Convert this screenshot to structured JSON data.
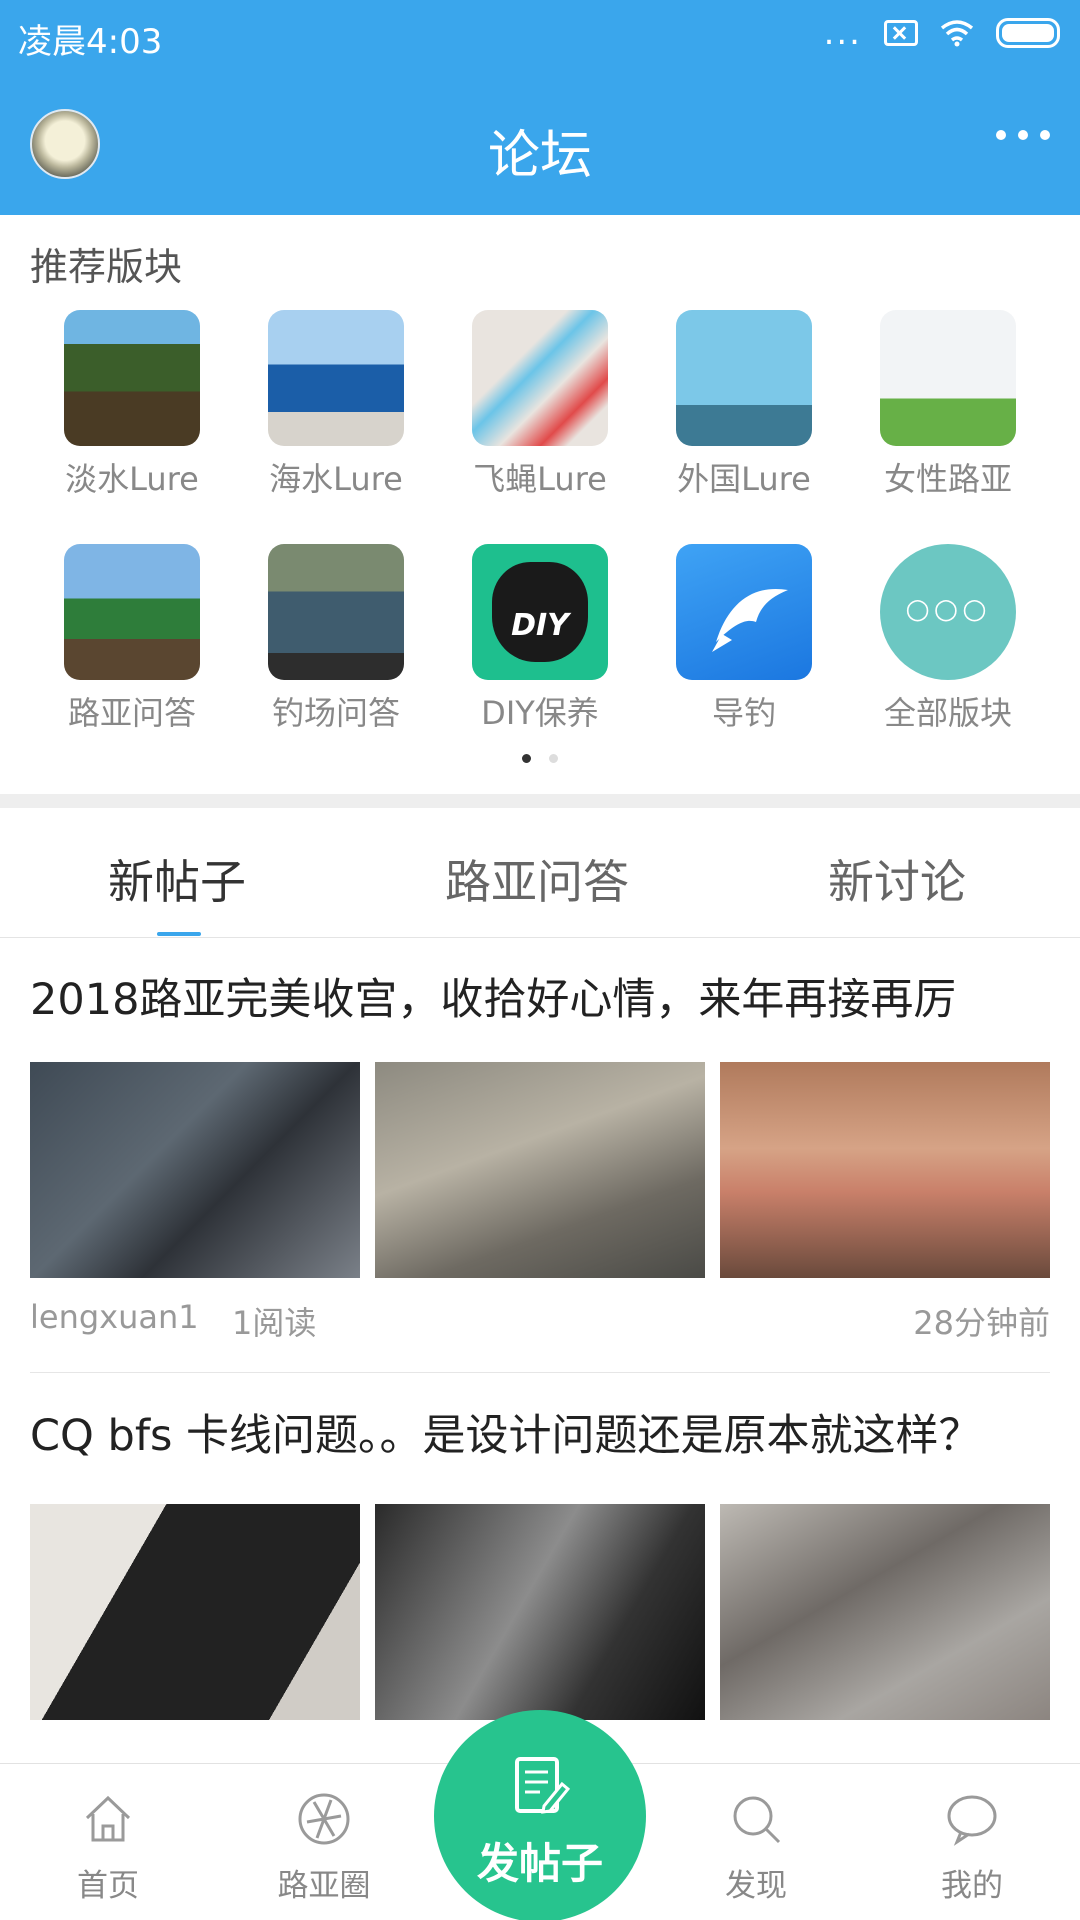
{
  "status_bar": {
    "time": "凌晨4:03",
    "dots": "...",
    "icons": [
      "dots-icon",
      "no-sim-icon",
      "wifi-icon",
      "battery-icon"
    ]
  },
  "appbar": {
    "title": "论坛"
  },
  "recommended": {
    "title": "推荐版块",
    "items": [
      {
        "label": "淡水Lure"
      },
      {
        "label": "海水Lure"
      },
      {
        "label": "飞蝇Lure"
      },
      {
        "label": "外国Lure"
      },
      {
        "label": "女性路亚"
      },
      {
        "label": "路亚问答"
      },
      {
        "label": "钓场问答"
      },
      {
        "label": "DIY保养",
        "badge": "DIY"
      },
      {
        "label": "导钓"
      },
      {
        "label": "全部版块"
      }
    ],
    "page": 1,
    "page_count": 2
  },
  "tabs": [
    {
      "label": "新帖子",
      "active": true
    },
    {
      "label": "路亚问答",
      "active": false
    },
    {
      "label": "新讨论",
      "active": false
    }
  ],
  "posts": [
    {
      "title": "2018路亚完美收宫，收拾好心情，来年再接再厉",
      "author": "lengxuan1",
      "reads": "1阅读",
      "time": "28分钟前"
    },
    {
      "title": "CQ bfs 卡线问题。。是设计问题还是原本就这样？"
    }
  ],
  "bottom_nav": {
    "items": [
      {
        "label": "首页",
        "icon": "home-icon"
      },
      {
        "label": "路亚圈",
        "icon": "aperture-icon"
      },
      {
        "label": "发现",
        "icon": "search-icon"
      },
      {
        "label": "我的",
        "icon": "chat-bubble-icon"
      }
    ],
    "fab_label": "发帖子"
  },
  "colors": {
    "primary": "#3aa6ec",
    "fab": "#27c48e"
  }
}
